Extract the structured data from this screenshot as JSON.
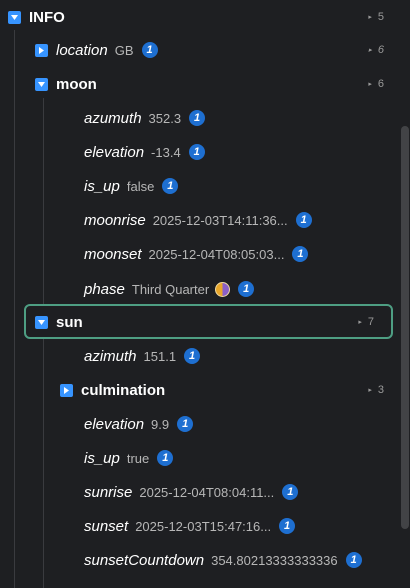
{
  "root": {
    "label": "INFO",
    "count": "5"
  },
  "location": {
    "key": "location",
    "value": "GB",
    "badge": "1",
    "count": "6"
  },
  "moon": {
    "label": "moon",
    "count": "6",
    "items": [
      {
        "key": "azumuth",
        "value": "352.3",
        "badge": "1"
      },
      {
        "key": "elevation",
        "value": "-13.4",
        "badge": "1"
      },
      {
        "key": "is_up",
        "value": "false",
        "badge": "1"
      },
      {
        "key": "moonrise",
        "value": "2025-12-03T14:11:36...",
        "badge": "1"
      },
      {
        "key": "moonset",
        "value": "2025-12-04T08:05:03...",
        "badge": "1"
      },
      {
        "key": "phase",
        "value": "Third Quarter",
        "badge": "1"
      }
    ]
  },
  "sun": {
    "label": "sun",
    "count": "7",
    "azimuth": {
      "key": "azimuth",
      "value": "151.1",
      "badge": "1"
    },
    "culmination": {
      "label": "culmination",
      "count": "3"
    },
    "items": [
      {
        "key": "elevation",
        "value": "9.9",
        "badge": "1"
      },
      {
        "key": "is_up",
        "value": "true",
        "badge": "1"
      },
      {
        "key": "sunrise",
        "value": "2025-12-04T08:04:11...",
        "badge": "1"
      },
      {
        "key": "sunset",
        "value": "2025-12-03T15:47:16...",
        "badge": "1"
      },
      {
        "key": "sunsetCountdown",
        "value": "354.80213333333336",
        "badge": "1"
      }
    ]
  },
  "icons": {
    "expanded": "chevron-down-icon",
    "collapsed": "chevron-right-icon",
    "phase": "moon-phase-icon"
  },
  "colors": {
    "toggle": "#3794ff",
    "badge": "#1e6fd1",
    "selected_border": "#4e9e83",
    "background": "#1e1f22"
  }
}
